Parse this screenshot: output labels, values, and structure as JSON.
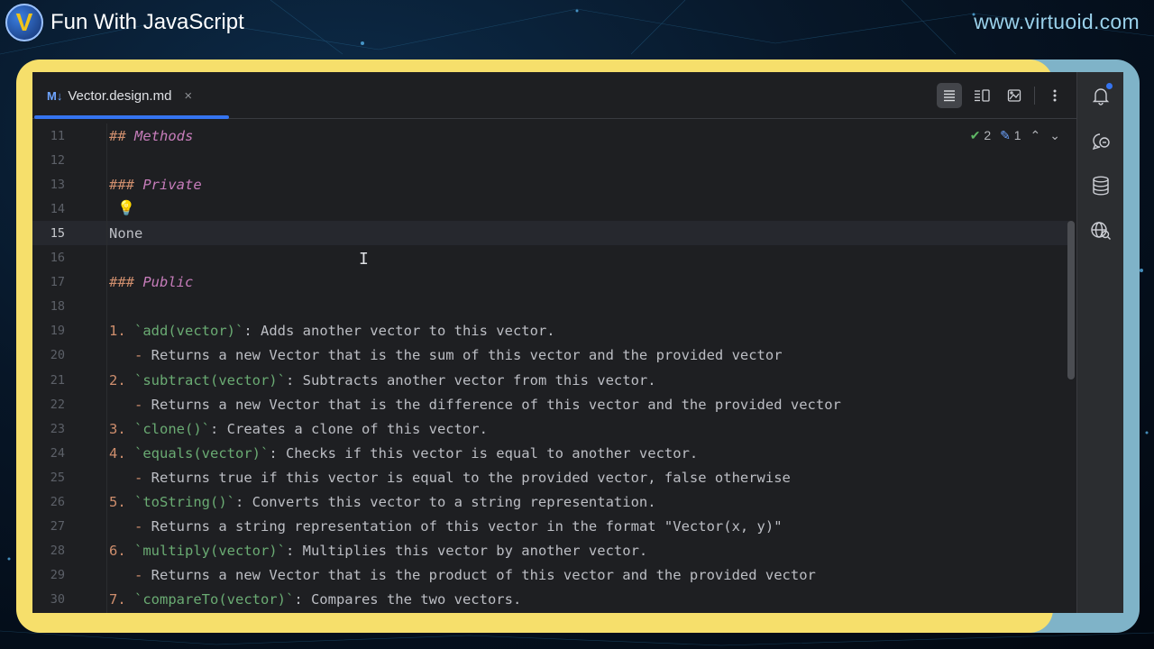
{
  "brand": {
    "title": "Fun With JavaScript",
    "url": "www.virtuoid.com",
    "logo_letter": "V"
  },
  "tab": {
    "icon_label": "M↓",
    "file_name": "Vector.design.md",
    "close_glyph": "×"
  },
  "inspections": {
    "ok_count": "2",
    "warn_count": "1"
  },
  "colors": {
    "accent": "#3574f0",
    "frame": "#f6df6b",
    "editor_bg": "#1e1f22"
  },
  "lines": [
    {
      "n": "11",
      "parts": [
        {
          "c": "h",
          "t": "## "
        },
        {
          "c": "ht",
          "t": "Methods"
        }
      ]
    },
    {
      "n": "12",
      "parts": []
    },
    {
      "n": "13",
      "parts": [
        {
          "c": "h",
          "t": "### "
        },
        {
          "c": "ht",
          "t": "Private"
        }
      ]
    },
    {
      "n": "14",
      "parts": []
    },
    {
      "n": "15",
      "current": true,
      "parts": [
        {
          "c": "txt",
          "t": "None"
        }
      ]
    },
    {
      "n": "16",
      "parts": []
    },
    {
      "n": "17",
      "parts": [
        {
          "c": "h",
          "t": "### "
        },
        {
          "c": "ht",
          "t": "Public"
        }
      ]
    },
    {
      "n": "18",
      "parts": []
    },
    {
      "n": "19",
      "parts": [
        {
          "c": "num",
          "t": "1. "
        },
        {
          "c": "ic",
          "t": "`add(vector)`"
        },
        {
          "c": "txt",
          "t": ": Adds another vector to this vector."
        }
      ]
    },
    {
      "n": "20",
      "parts": [
        {
          "c": "num",
          "t": "   - "
        },
        {
          "c": "txt",
          "t": "Returns a new Vector that is the sum of this vector and the provided vector"
        }
      ]
    },
    {
      "n": "21",
      "parts": [
        {
          "c": "num",
          "t": "2. "
        },
        {
          "c": "ic",
          "t": "`subtract(vector)`"
        },
        {
          "c": "txt",
          "t": ": Subtracts another vector from this vector."
        }
      ]
    },
    {
      "n": "22",
      "parts": [
        {
          "c": "num",
          "t": "   - "
        },
        {
          "c": "txt",
          "t": "Returns a new Vector that is the difference of this vector and the provided vector"
        }
      ]
    },
    {
      "n": "23",
      "parts": [
        {
          "c": "num",
          "t": "3. "
        },
        {
          "c": "ic",
          "t": "`clone()`"
        },
        {
          "c": "txt",
          "t": ": Creates a clone of this vector."
        }
      ]
    },
    {
      "n": "24",
      "parts": [
        {
          "c": "num",
          "t": "4. "
        },
        {
          "c": "ic",
          "t": "`equals(vector)`"
        },
        {
          "c": "txt",
          "t": ": Checks if this vector is equal to another vector."
        }
      ]
    },
    {
      "n": "25",
      "parts": [
        {
          "c": "num",
          "t": "   - "
        },
        {
          "c": "txt",
          "t": "Returns true if this vector is equal to the provided vector, false otherwise"
        }
      ]
    },
    {
      "n": "26",
      "parts": [
        {
          "c": "num",
          "t": "5. "
        },
        {
          "c": "ic",
          "t": "`toString()`"
        },
        {
          "c": "txt",
          "t": ": Converts this vector to a string representation."
        }
      ]
    },
    {
      "n": "27",
      "parts": [
        {
          "c": "num",
          "t": "   - "
        },
        {
          "c": "txt",
          "t": "Returns a string representation of this vector in the format \"Vector(x, y)\""
        }
      ]
    },
    {
      "n": "28",
      "parts": [
        {
          "c": "num",
          "t": "6. "
        },
        {
          "c": "ic",
          "t": "`multiply(vector)`"
        },
        {
          "c": "txt",
          "t": ": Multiplies this vector by another vector."
        }
      ]
    },
    {
      "n": "29",
      "parts": [
        {
          "c": "num",
          "t": "   - "
        },
        {
          "c": "txt",
          "t": "Returns a new Vector that is the product of this vector and the provided vector"
        }
      ]
    },
    {
      "n": "30",
      "parts": [
        {
          "c": "num",
          "t": "7. "
        },
        {
          "c": "ic",
          "t": "`compareTo(vector)`"
        },
        {
          "c": "txt",
          "t": ": Compares the two vectors."
        }
      ]
    }
  ]
}
